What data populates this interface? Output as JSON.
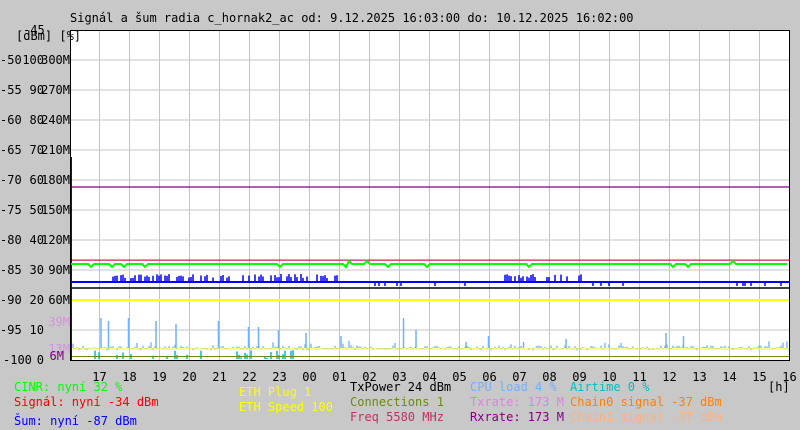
{
  "title": "Signál a šum radia c_hornak2_ac od: 9.12.2025 16:03:00 do: 10.12.2025 16:02:00",
  "chart_data": {
    "type": "line",
    "title": "Signál a šum radia c_hornak2_ac od: 9.12.2025 16:03:00 do: 10.12.2025 16:02:00",
    "x_range": [
      "9.12.2025 16:03:00",
      "10.12.2025 16:02:00"
    ],
    "xlabel": "[h]",
    "x_ticks": [
      "17",
      "18",
      "19",
      "20",
      "21",
      "22",
      "23",
      "00",
      "01",
      "02",
      "03",
      "04",
      "05",
      "06",
      "07",
      "08",
      "09",
      "10",
      "11",
      "12",
      "13",
      "14",
      "15",
      "16"
    ],
    "y_axis_header": "[dBm] [%]",
    "y_axes": {
      "dbm": {
        "range": [
          -100,
          -45
        ],
        "ticks": [
          "-45",
          "-50",
          "-55",
          "-60",
          "-65",
          "-70",
          "-75",
          "-80",
          "-85",
          "-90",
          "-95",
          "-100"
        ]
      },
      "percent": {
        "range": [
          0,
          110
        ],
        "ticks": [
          "100",
          "90",
          "80",
          "70",
          "60",
          "50",
          "40",
          "30",
          "20",
          "10",
          "0"
        ]
      },
      "mbit": {
        "range": [
          0,
          330
        ],
        "ticks": [
          "300M",
          "270M",
          "240M",
          "210M",
          "180M",
          "150M",
          "120M",
          "90M",
          "60M"
        ]
      }
    },
    "extra_tick_labels": [
      {
        "text": "39M",
        "color": "#d890e0"
      },
      {
        "text": "13M",
        "color": "#d890e0"
      },
      {
        "text": "6M",
        "color": "#800080"
      }
    ],
    "grid": true,
    "series": [
      {
        "name": "CINR",
        "unit": "%",
        "color": "#00ff00",
        "baseline": 32
      },
      {
        "name": "Freq",
        "color": "#d02060",
        "baseline_percent": 33.3
      },
      {
        "name": "Šum",
        "unit": "dBm",
        "color": "#0000ff",
        "baseline": -87
      },
      {
        "name": "Signal reference",
        "unit": "dBm",
        "color": "#000000",
        "baseline": -88
      },
      {
        "name": "Rxrate",
        "unit": "M",
        "color": "#800080",
        "baseline": 173
      },
      {
        "name": "ETH Speed",
        "unit": "M",
        "color": "#ffff00",
        "baseline": 60
      },
      {
        "name": "CPU load",
        "unit": "%",
        "color": "#70b0ff",
        "baseline": 4,
        "spikes": [
          [
            "17:05",
            14
          ],
          [
            "17:20",
            13
          ],
          [
            "18:00",
            14
          ],
          [
            "18:55",
            13
          ],
          [
            "19:35",
            12
          ],
          [
            "21:00",
            13
          ],
          [
            "22:00",
            11
          ],
          [
            "22:20",
            11
          ],
          [
            "23:00",
            10
          ],
          [
            "23:55",
            9
          ],
          [
            "01:05",
            8
          ],
          [
            "03:10",
            14
          ],
          [
            "03:35",
            10
          ],
          [
            "05:15",
            6
          ],
          [
            "06:00",
            8
          ],
          [
            "07:10",
            6
          ],
          [
            "08:35",
            7
          ],
          [
            "11:55",
            9
          ],
          [
            "12:30",
            8
          ]
        ]
      },
      {
        "name": "Connections",
        "color": "#6a8a10",
        "baseline_percent": 1.3
      },
      {
        "name": "Airtime",
        "unit": "%",
        "color": "#00c0c0",
        "baseline": 0
      }
    ]
  },
  "legend": {
    "cinr": "CINR: nyní 32 %",
    "signal": "Signál: nyní -34 dBm",
    "noise": "Šum: nyní -87 dBm",
    "eth_plug": "ETH Plug 1",
    "eth_speed": "ETH Speed 100",
    "txpower": "TxPower 24 dBm",
    "connections": "Connections 1",
    "freq": "Freq 5580 MHz",
    "cpu": "CPU load 4 %",
    "txrate": "Txrate: 173 M",
    "rxrate": "Rxrate: 173 M",
    "airtime": "Airtime 0 %",
    "chain0": "Chain0 signal -37 dBm",
    "chain1": "Chain1 signal -37 dBm"
  },
  "colors": {
    "cinr": "#00ff00",
    "signal": "#ff0000",
    "noise": "#0000ff",
    "eth": "#ffff00",
    "txpower": "#000000",
    "connections": "#6a8a10",
    "freq": "#c03060",
    "cpu": "#70b0ff",
    "txrate": "#e080e0",
    "rxrate": "#800080",
    "airtime": "#00c0c0",
    "chain0": "#ff8000",
    "chain1": "#ffb080"
  }
}
